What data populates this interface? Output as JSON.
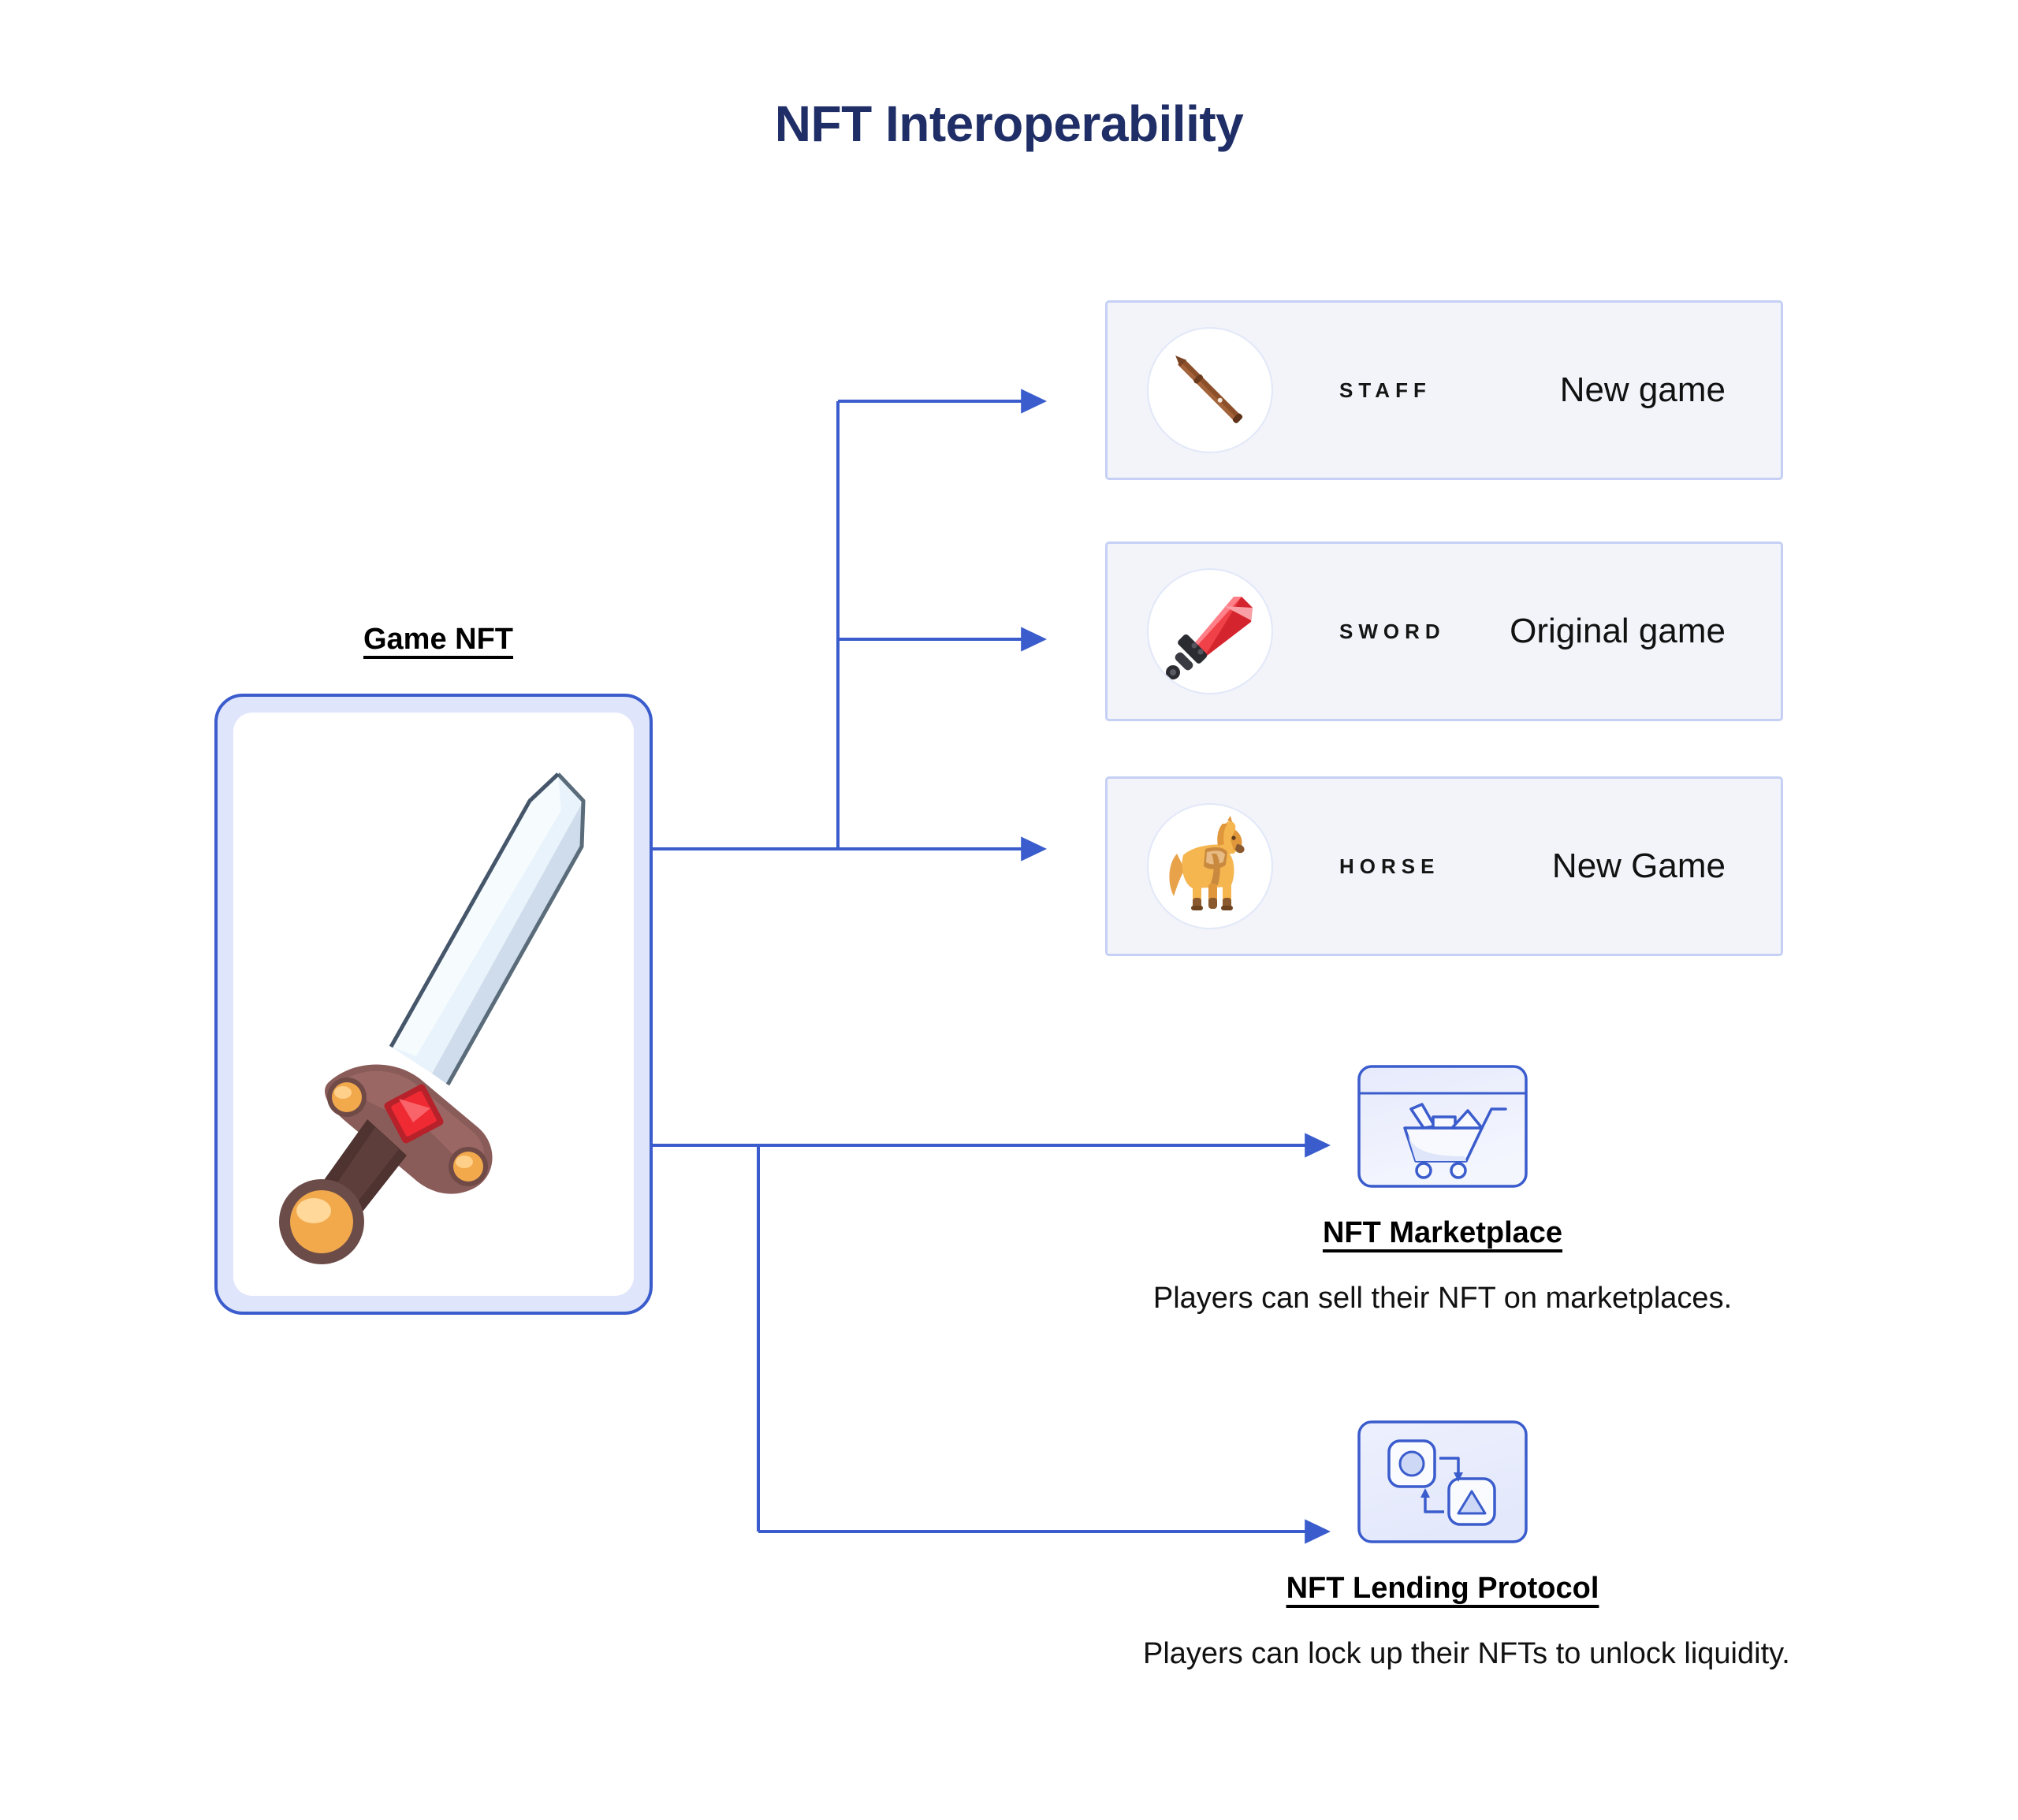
{
  "title": "NFT Interoperability",
  "colors": {
    "title": "#1f2e66",
    "arrow": "#3a5ccc",
    "card_border": "#3a5ccc",
    "card_band": "#dfe5fb",
    "row_fill": "#f2f4fa",
    "row_border": "#c5d0f4"
  },
  "nft": {
    "label": "Game NFT",
    "artwork_name": "sword-nft-artwork"
  },
  "items": [
    {
      "icon": "staff-icon",
      "tag": "STAFF",
      "game": "New game"
    },
    {
      "icon": "sword-icon",
      "tag": "SWORD",
      "game": "Original game"
    },
    {
      "icon": "horse-icon",
      "tag": "HORSE",
      "game": "New Game"
    }
  ],
  "destinations": [
    {
      "icon": "marketplace-browser-cart-icon",
      "title": "NFT Marketplace",
      "caption": "Players can sell their NFT on marketplaces."
    },
    {
      "icon": "lending-swap-icon",
      "title": "NFT Lending Protocol",
      "caption": "Players can lock up their NFTs to unlock liquidity."
    }
  ]
}
